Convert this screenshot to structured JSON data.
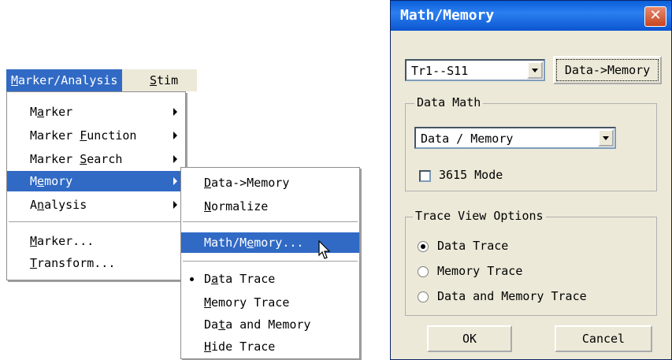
{
  "menubar": {
    "items": [
      {
        "label": "Marker/Analysis",
        "ul": "M",
        "rest": "arker/Analysis"
      },
      {
        "label": "Stim",
        "ul": "S",
        "rest": "tim"
      }
    ]
  },
  "analysis_menu": {
    "items": [
      {
        "pre": "M",
        "ul": "a",
        "post": "rker"
      },
      {
        "pre": "Marker ",
        "ul": "F",
        "post": "unction"
      },
      {
        "pre": "Marker ",
        "ul": "S",
        "post": "earch"
      },
      {
        "pre": "M",
        "ul": "e",
        "post": "mory"
      },
      {
        "pre": "A",
        "ul": "n",
        "post": "alysis"
      },
      {
        "pre": "",
        "ul": "M",
        "post": "arker..."
      },
      {
        "pre": "",
        "ul": "T",
        "post": "ransform..."
      }
    ]
  },
  "memory_menu": {
    "items": [
      {
        "pre": "",
        "ul": "D",
        "post": "ata->Memory"
      },
      {
        "pre": "",
        "ul": "N",
        "post": "ormalize"
      },
      {
        "pre": "Math/M",
        "ul": "e",
        "post": "mory..."
      },
      {
        "pre": "D",
        "ul": "a",
        "post": "ta Trace"
      },
      {
        "pre": "",
        "ul": "M",
        "post": "emory Trace"
      },
      {
        "pre": "Da",
        "ul": "t",
        "post": "a and Memory"
      },
      {
        "pre": "",
        "ul": "H",
        "post": "ide Trace"
      }
    ]
  },
  "dialog": {
    "title": "Math/Memory",
    "close_label": "✕",
    "trace_select": "Tr1--S11",
    "data_to_memory": "Data->Memory",
    "data_math_label": "Data Math",
    "math_select": "Data / Memory",
    "mode_label": "3615 Mode",
    "trace_view_label": "Trace View Options",
    "radio_options": [
      "Data Trace",
      "Memory Trace",
      "Data and Memory Trace"
    ],
    "ok": "OK",
    "cancel": "Cancel"
  }
}
